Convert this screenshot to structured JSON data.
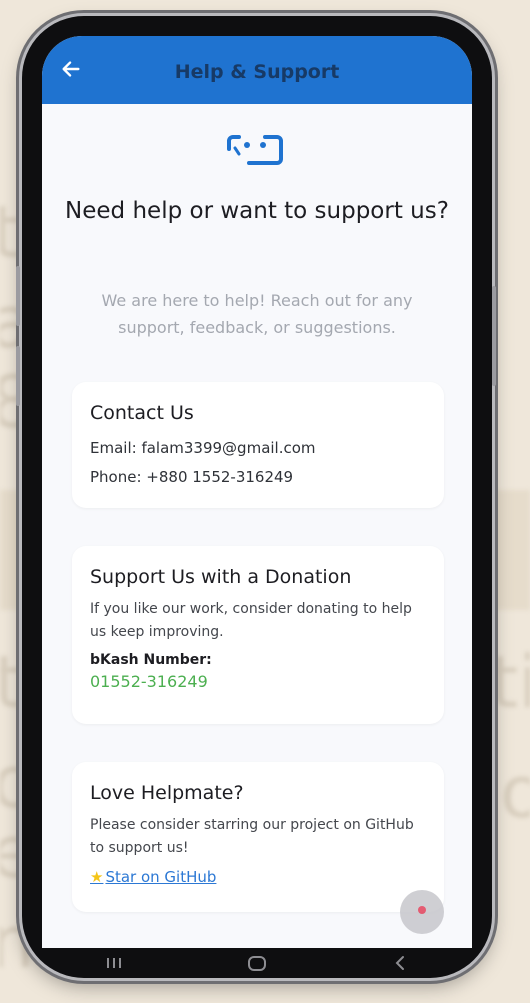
{
  "app_bar": {
    "title": "Help & Support",
    "back_icon": "arrow-left-icon",
    "background": "#1f73d0"
  },
  "header": {
    "logo_icon": "robot-face-icon",
    "headline": "Need help or want to support us?",
    "subtitle": "We are here to help! Reach out for any support, feedback, or suggestions."
  },
  "contact": {
    "title": "Contact Us",
    "email": "Email: falam3399@gmail.com",
    "phone": "Phone: +880 1552-316249"
  },
  "donation": {
    "title": "Support Us with a Donation",
    "description": "If you like our work, consider donating to help us keep improving.",
    "bkash_label": "bKash Number:",
    "bkash_number": "01552-316249",
    "number_color": "#4caf50"
  },
  "github": {
    "title": "Love Helpmate?",
    "description": "Please consider starring our project on GitHub to support us!",
    "link_label": "Star on GitHub",
    "link_icon": "star-icon"
  },
  "system_nav": {
    "recent_icon": "recent-apps-icon",
    "home_icon": "home-icon",
    "back_icon": "back-nav-icon"
  }
}
